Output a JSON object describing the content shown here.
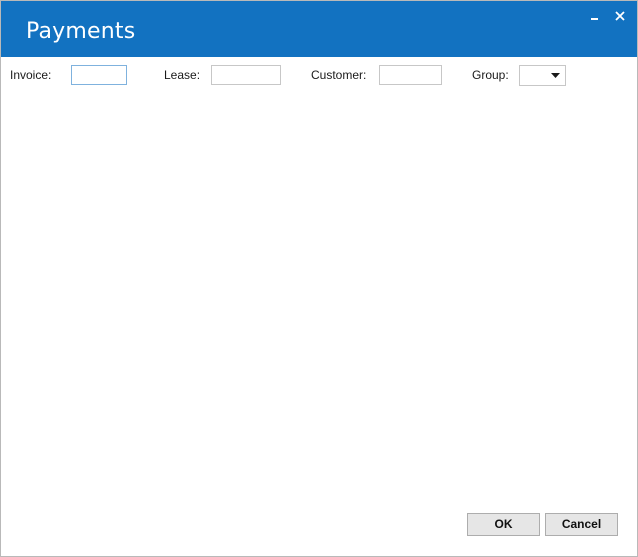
{
  "window": {
    "title": "Payments",
    "minimize_icon": "minimize-icon",
    "close_icon": "close-icon",
    "titlebar_color": "#1272c1"
  },
  "filters": {
    "invoice": {
      "label": "Invoice:",
      "value": ""
    },
    "lease": {
      "label": "Lease:",
      "value": ""
    },
    "customer": {
      "label": "Customer:",
      "value": ""
    },
    "group": {
      "label": "Group:",
      "selected": "",
      "arrow_icon": "chevron-down-icon"
    }
  },
  "buttons": {
    "ok_label": "OK",
    "cancel_label": "Cancel"
  }
}
